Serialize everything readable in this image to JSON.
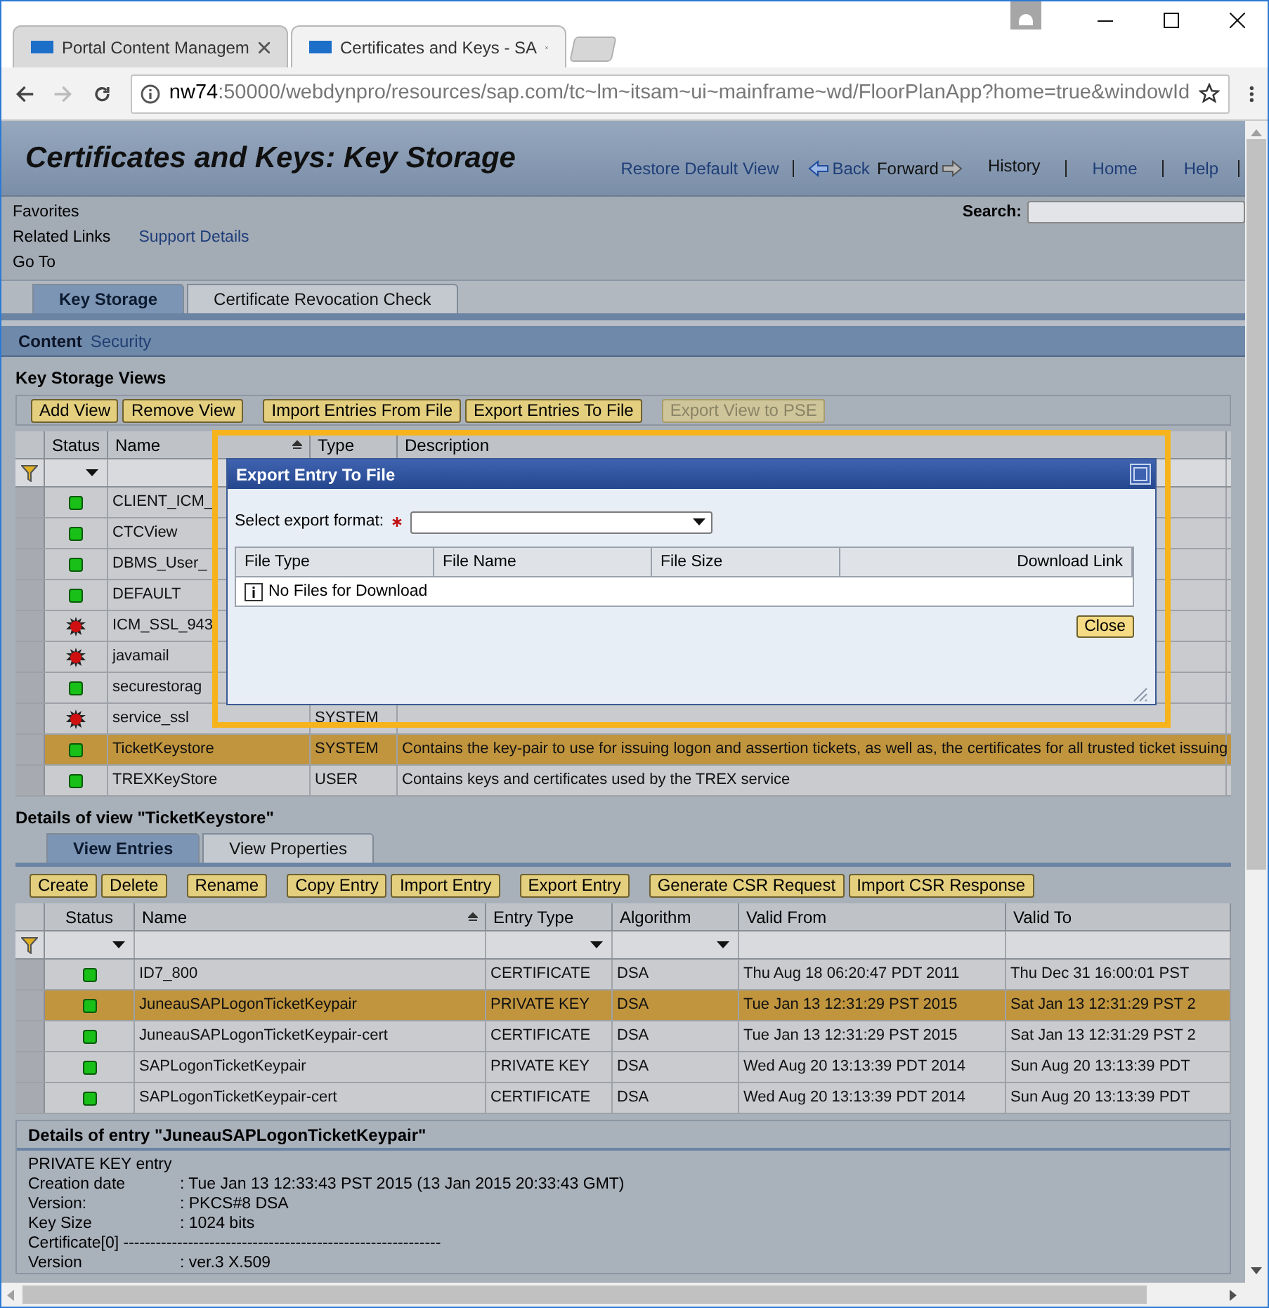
{
  "browser": {
    "tabs": [
      {
        "title": "Portal Content Managem",
        "selected": false
      },
      {
        "title": "Certificates and Keys - SA",
        "selected": true
      }
    ],
    "url_host": "nw74",
    "url_rest": ":50000/webdynpro/resources/sap.com/tc~lm~itsam~ui~mainframe~wd/FloorPlanApp?home=true&windowId"
  },
  "header": {
    "title": "Certificates and Keys: Key Storage",
    "restore": "Restore Default View",
    "back": "Back",
    "forward": "Forward",
    "history": "History",
    "home": "Home",
    "help": "Help"
  },
  "nav": {
    "menus": [
      "Favorites",
      "Related Links",
      "Go To"
    ],
    "support_link": "Support Details",
    "search_label": "Search:"
  },
  "page_tabs": [
    {
      "label": "Key Storage",
      "selected": true
    },
    {
      "label": "Certificate Revocation Check",
      "selected": false
    }
  ],
  "section_bar": [
    {
      "label": "Content",
      "selected": true
    },
    {
      "label": "Security",
      "selected": false
    }
  ],
  "views": {
    "title": "Key Storage Views",
    "toolbar": [
      [
        {
          "label": "Add View",
          "disabled": false
        },
        {
          "label": "Remove View",
          "disabled": false
        }
      ],
      [
        {
          "label": "Import Entries From File",
          "disabled": false
        },
        {
          "label": "Export Entries To File",
          "disabled": false
        }
      ],
      [
        {
          "label": "Export View to PSE",
          "disabled": true
        }
      ]
    ],
    "columns": [
      {
        "label": "Status",
        "sort_icon": false,
        "filter_dropdown": true
      },
      {
        "label": "Name",
        "sort_icon": true,
        "filter_dropdown": false
      },
      {
        "label": "Type",
        "sort_icon": false
      },
      {
        "label": "Description",
        "sort_icon": false
      }
    ],
    "rows": [
      {
        "status_ok": true,
        "name": "CLIENT_ICM_",
        "selected": false
      },
      {
        "status_ok": true,
        "name": "CTCView",
        "selected": false
      },
      {
        "status_ok": true,
        "name": "DBMS_User_",
        "selected": false
      },
      {
        "status_ok": true,
        "name": "DEFAULT",
        "selected": false
      },
      {
        "status_ok": false,
        "name": "ICM_SSL_943",
        "selected": false
      },
      {
        "status_ok": false,
        "name": "javamail",
        "selected": false
      },
      {
        "status_ok": true,
        "name": "securestorag",
        "selected": false
      },
      {
        "status_ok": false,
        "name": "service_ssl",
        "type": "SYSTEM",
        "selected": false
      },
      {
        "status_ok": true,
        "name": "TicketKeystore",
        "type": "SYSTEM",
        "description": "Contains the key-pair to use for issuing logon and assertion tickets, as well as, the certificates for all trusted ticket issuing",
        "selected": true
      },
      {
        "status_ok": true,
        "name": "TREXKeyStore",
        "type": "USER",
        "description": "Contains keys and certificates used by the TREX service",
        "selected": false
      }
    ]
  },
  "dialog": {
    "title": "Export Entry To File",
    "field_label": "Select export format:",
    "required": true,
    "columns": [
      "File Type",
      "File Name",
      "File Size",
      "Download Link"
    ],
    "empty_message": "No Files for Download",
    "button": "Close"
  },
  "details_view": {
    "title": "Details of view \"TicketKeystore\"",
    "tabs": [
      {
        "label": "View Entries",
        "selected": true
      },
      {
        "label": "View Properties",
        "selected": false
      }
    ],
    "toolbar": [
      [
        {
          "label": "Create",
          "disabled": false
        },
        {
          "label": "Delete",
          "disabled": false
        }
      ],
      [
        {
          "label": "Rename",
          "disabled": false
        }
      ],
      [
        {
          "label": "Copy Entry",
          "disabled": false
        },
        {
          "label": "Import Entry",
          "disabled": false
        }
      ],
      [
        {
          "label": "Export Entry",
          "disabled": false
        }
      ],
      [
        {
          "label": "Generate CSR Request",
          "disabled": false
        },
        {
          "label": "Import CSR Response",
          "disabled": false
        }
      ]
    ],
    "columns": [
      {
        "label": "Status",
        "sort_icon": false,
        "filter_dropdown": true
      },
      {
        "label": "Name",
        "sort_icon": true,
        "filter_dropdown": false
      },
      {
        "label": "Entry Type",
        "sort_icon": false,
        "filter_dropdown": true
      },
      {
        "label": "Algorithm",
        "sort_icon": false,
        "filter_dropdown": true
      },
      {
        "label": "Valid From",
        "sort_icon": false,
        "filter_dropdown": false
      },
      {
        "label": "Valid To",
        "sort_icon": false,
        "filter_dropdown": false
      }
    ],
    "rows": [
      {
        "status_ok": true,
        "name": "ID7_800",
        "entry_type": "CERTIFICATE",
        "algorithm": "DSA",
        "valid_from": "Thu Aug 18 06:20:47 PDT 2011",
        "valid_to": "Thu Dec 31 16:00:01 PST",
        "selected": false
      },
      {
        "status_ok": true,
        "name": "JuneauSAPLogonTicketKeypair",
        "entry_type": "PRIVATE KEY",
        "algorithm": "DSA",
        "valid_from": "Tue Jan 13 12:31:29 PST 2015",
        "valid_to": "Sat Jan 13 12:31:29 PST 2",
        "selected": true
      },
      {
        "status_ok": true,
        "name": "JuneauSAPLogonTicketKeypair-cert",
        "entry_type": "CERTIFICATE",
        "algorithm": "DSA",
        "valid_from": "Tue Jan 13 12:31:29 PST 2015",
        "valid_to": "Sat Jan 13 12:31:29 PST 2",
        "selected": false
      },
      {
        "status_ok": true,
        "name": "SAPLogonTicketKeypair",
        "entry_type": "PRIVATE KEY",
        "algorithm": "DSA",
        "valid_from": "Wed Aug 20 13:13:39 PDT 2014",
        "valid_to": "Sun Aug 20 13:13:39 PDT",
        "selected": false
      },
      {
        "status_ok": true,
        "name": "SAPLogonTicketKeypair-cert",
        "entry_type": "CERTIFICATE",
        "algorithm": "DSA",
        "valid_from": "Wed Aug 20 13:13:39 PDT 2014",
        "valid_to": "Sun Aug 20 13:13:39 PDT",
        "selected": false
      }
    ]
  },
  "entry_details": {
    "title": "Details of entry \"JuneauSAPLogonTicketKeypair\"",
    "lines": [
      {
        "label": "PRIVATE KEY entry"
      },
      {
        "label": "Creation date",
        "value": ": Tue Jan 13 12:33:43 PST 2015 (13 Jan 2015 20:33:43 GMT)"
      },
      {
        "label": "Version:",
        "value": ": PKCS#8 DSA"
      },
      {
        "label": "Key Size",
        "value": ": 1024 bits"
      },
      {
        "label": "Certificate[0] -----------------------------------------------------------"
      },
      {
        "label": "Version",
        "value": ": ver.3 X.509"
      }
    ]
  }
}
